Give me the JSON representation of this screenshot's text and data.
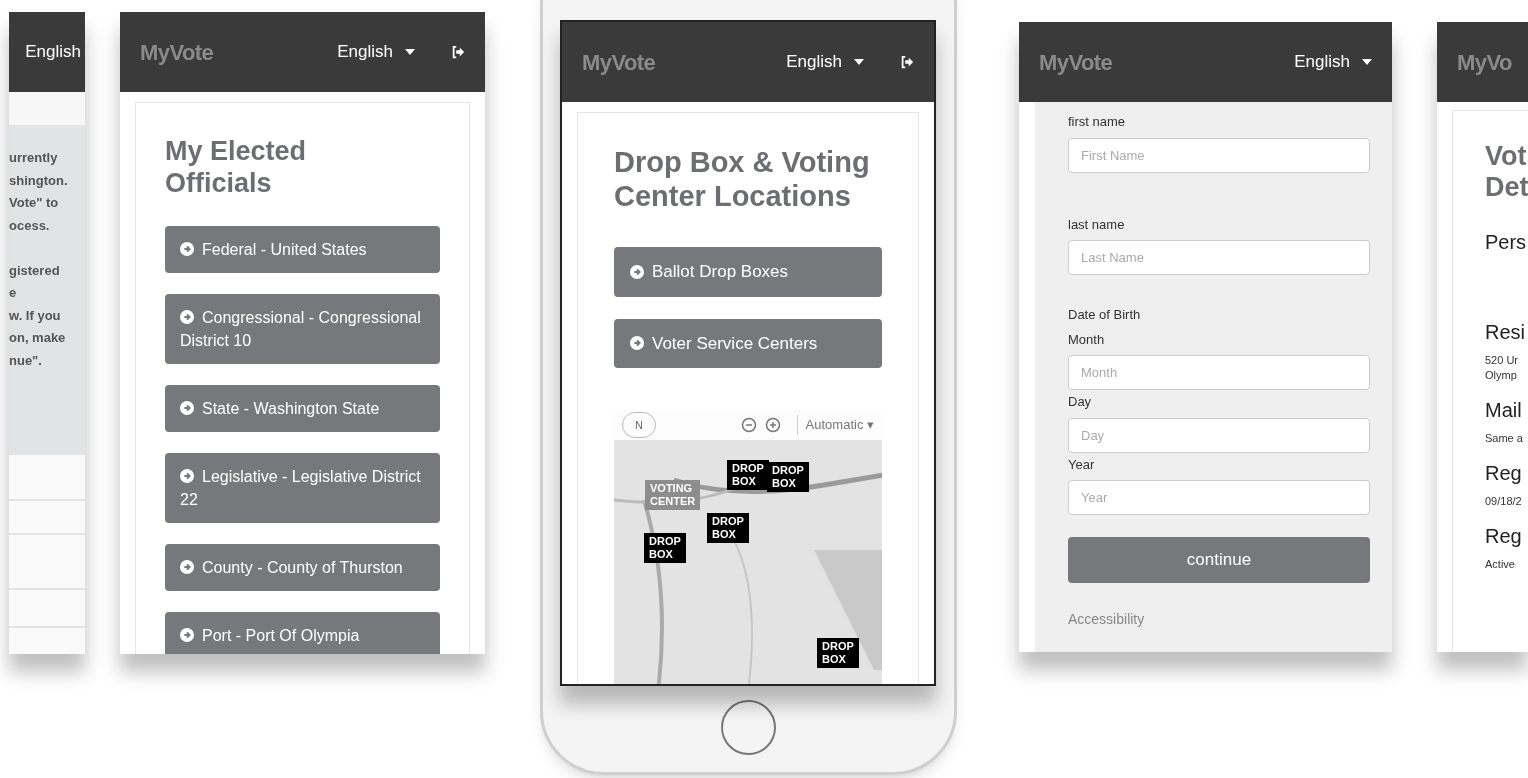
{
  "screens": [
    {
      "kind": "intro",
      "header": {
        "language": "English",
        "language_caret": false,
        "logout": false
      },
      "paragraphs": [
        [
          "urrently",
          "shington.",
          "Vote\" to",
          "ocess."
        ],
        [
          "gistered",
          "e",
          "w. If you",
          "on, make",
          "nue\"."
        ]
      ]
    },
    {
      "kind": "officials",
      "header": {
        "logo": "MyVote",
        "language": "English",
        "language_caret": true,
        "logout": true
      },
      "title": "My Elected Officials",
      "buttons": [
        "Federal - United States",
        "Congressional - Congressional District 10",
        "State - Washington State",
        "Legislative - Legislative District 22",
        "County - County of Thurston",
        "Port - Port Of Olympia"
      ]
    },
    {
      "kind": "locations",
      "header": {
        "logo": "MyVote",
        "language": "English",
        "language_caret": true,
        "logout": true
      },
      "title": "Drop Box & Voting Center Locations",
      "buttons": [
        "Ballot Drop Boxes",
        "Voter Service Centers"
      ],
      "map": {
        "compass": "N",
        "mode": "Automatic ▾",
        "markers": [
          {
            "kind": "drop",
            "lines": [
              "DROP",
              "BOX"
            ]
          },
          {
            "kind": "drop",
            "lines": [
              "DROP",
              "BOX"
            ]
          },
          {
            "kind": "drop",
            "lines": [
              "DROP",
              "BOX"
            ]
          },
          {
            "kind": "drop",
            "lines": [
              "DROP",
              "BOX"
            ]
          },
          {
            "kind": "drop",
            "lines": [
              "DROP",
              "BOX"
            ]
          },
          {
            "kind": "center",
            "lines": [
              "VOTING",
              "CENTER"
            ]
          }
        ]
      }
    },
    {
      "kind": "form",
      "header": {
        "logo": "MyVote",
        "language": "English",
        "language_caret": true,
        "logout": false
      },
      "fields": [
        {
          "label": "first name",
          "placeholder": "First Name"
        },
        {
          "label": "last name",
          "placeholder": "Last Name"
        },
        {
          "group": "Date of Birth",
          "label": "Month",
          "placeholder": "Month"
        },
        {
          "label": "Day",
          "placeholder": "Day"
        },
        {
          "label": "Year",
          "placeholder": "Year"
        }
      ],
      "submit": "continue",
      "footer_link": "Accessibility"
    },
    {
      "kind": "details",
      "header": {
        "logo": "MyVo",
        "logout": false
      },
      "title": [
        "Vot",
        "Det"
      ],
      "sections": [
        {
          "heading": "Pers"
        },
        {
          "heading": "Resi",
          "lines": [
            "520 Ur",
            "Olymp"
          ]
        },
        {
          "heading": "Mail",
          "lines": [
            "Same a"
          ]
        },
        {
          "heading": "Reg",
          "lines": [
            "09/18/2"
          ]
        },
        {
          "heading": "Reg",
          "lines": [
            "Active"
          ]
        }
      ]
    }
  ]
}
